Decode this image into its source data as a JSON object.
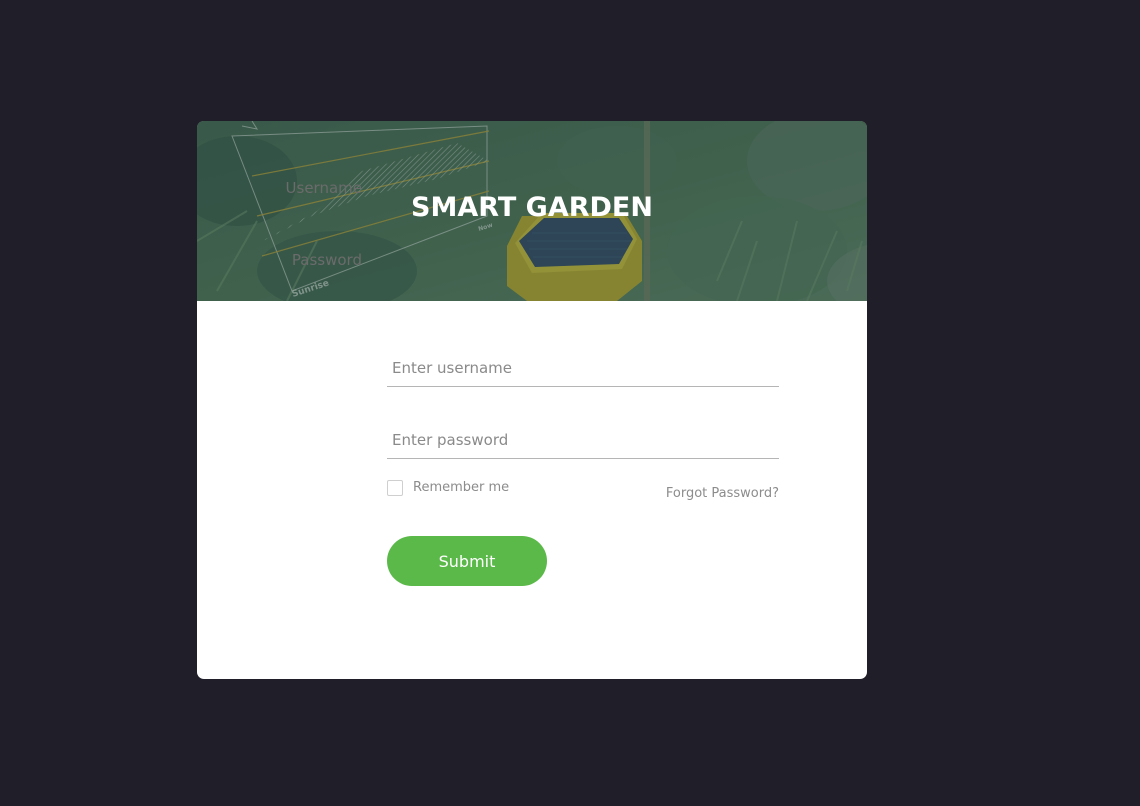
{
  "header": {
    "title": "SMART GARDEN",
    "image_labels": {
      "sunrise": "Sunrise",
      "now": "Now"
    }
  },
  "form": {
    "username_label": "Username",
    "username_placeholder": "Enter username",
    "password_label": "Password",
    "password_placeholder": "Enter password",
    "remember_label": "Remember me",
    "forgot_label": "Forgot Password?",
    "submit_label": "Submit"
  },
  "colors": {
    "page_background": "#1f1e29",
    "card_background": "#ffffff",
    "accent_green": "#5bb94a",
    "header_overlay": "#3e5a4a"
  }
}
